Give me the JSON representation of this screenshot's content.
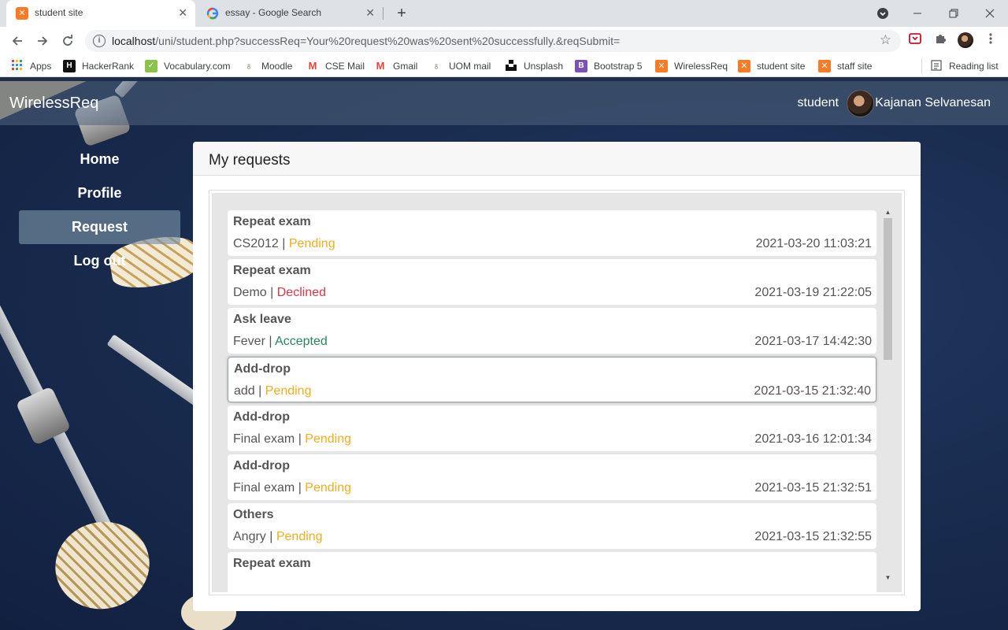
{
  "browser": {
    "tabs": [
      {
        "title": "student site",
        "close": "✕",
        "active": true
      },
      {
        "title": "essay - Google Search",
        "close": "✕",
        "active": false
      }
    ],
    "new_tab": "+",
    "url_host": "localhost",
    "url_path": "/uni/student.php?successReq=Your%20request%20was%20sent%20successfully.&reqSubmit=",
    "bookmarks": [
      {
        "label": "Apps",
        "icon": "apps-grid-icon"
      },
      {
        "label": "HackerRank",
        "icon": "hackerrank-icon"
      },
      {
        "label": "Vocabulary.com",
        "icon": "vocabulary-icon"
      },
      {
        "label": "Moodle",
        "icon": "moodle-icon"
      },
      {
        "label": "CSE Mail",
        "icon": "gmail-icon"
      },
      {
        "label": "Gmail",
        "icon": "gmail-icon"
      },
      {
        "label": "UOM mail",
        "icon": "uom-icon"
      },
      {
        "label": "Unsplash",
        "icon": "unsplash-icon"
      },
      {
        "label": "Bootstrap 5",
        "icon": "bootstrap-icon"
      },
      {
        "label": "WirelessReq",
        "icon": "xampp-icon"
      },
      {
        "label": "student site",
        "icon": "xampp-icon"
      },
      {
        "label": "staff site",
        "icon": "xampp-icon"
      }
    ],
    "reading_list": "Reading list"
  },
  "app": {
    "brand": "WirelessReq",
    "role": "student",
    "user_name": "Kajanan Selvanesan"
  },
  "nav": {
    "items": [
      {
        "label": "Home",
        "active": false
      },
      {
        "label": "Profile",
        "active": false
      },
      {
        "label": "Request",
        "active": true
      },
      {
        "label": "Log out",
        "active": false
      }
    ]
  },
  "card": {
    "title": "My requests"
  },
  "requests": [
    {
      "type": "Repeat exam",
      "subject": "CS2012",
      "sep": " | ",
      "status": "Pending",
      "date": "2021-03-20 11:03:21"
    },
    {
      "type": "Repeat exam",
      "subject": "Demo",
      "sep": " | ",
      "status": "Declined",
      "date": "2021-03-19 21:22:05"
    },
    {
      "type": "Ask leave",
      "subject": "Fever",
      "sep": " | ",
      "status": "Accepted",
      "date": "2021-03-17 14:42:30"
    },
    {
      "type": "Add-drop",
      "subject": "add",
      "sep": " | ",
      "status": "Pending",
      "date": "2021-03-15 21:32:40"
    },
    {
      "type": "Add-drop",
      "subject": "Final exam",
      "sep": " | ",
      "status": "Pending",
      "date": "2021-03-16 12:01:34"
    },
    {
      "type": "Add-drop",
      "subject": "Final exam",
      "sep": " | ",
      "status": "Pending",
      "date": "2021-03-15 21:32:51"
    },
    {
      "type": "Others",
      "subject": "Angry",
      "sep": " | ",
      "status": "Pending",
      "date": "2021-03-15 21:32:55"
    },
    {
      "type": "Repeat exam",
      "subject": "",
      "sep": "",
      "status": "",
      "date": ""
    }
  ],
  "colors": {
    "pending": "#f0ad1e",
    "declined": "#dc3545",
    "accepted": "#28865a"
  }
}
